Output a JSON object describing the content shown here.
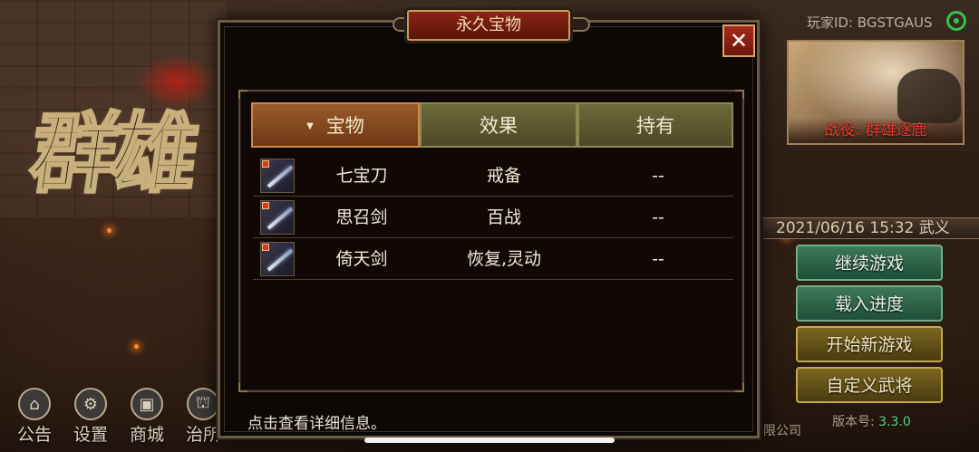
{
  "background": {
    "logo_text": "群雄",
    "player_id": "玩家ID: BGSTGAUS",
    "campaign_title": "战役: 群雄逐鹿",
    "save_info": "2021/06/16 15:32 武义",
    "company_text": "限公司",
    "version_label": "版本号: ",
    "version_value": "3.3.0",
    "menu_buttons": [
      "继续游戏",
      "载入进度",
      "开始新游戏",
      "自定义武将"
    ],
    "bottom_menu": [
      {
        "label": "公告",
        "icon": "notice-icon"
      },
      {
        "label": "设置",
        "icon": "gear-icon"
      },
      {
        "label": "商城",
        "icon": "shop-icon"
      },
      {
        "label": "治所",
        "icon": "pavilion-icon"
      }
    ]
  },
  "modal": {
    "title": "永久宝物",
    "close_label": "✕",
    "columns": [
      {
        "label": "宝物",
        "active": true,
        "sort_indicator": "▼"
      },
      {
        "label": "效果",
        "active": false
      },
      {
        "label": "持有",
        "active": false
      }
    ],
    "rows": [
      {
        "name": "七宝刀",
        "effect": "戒备",
        "held": "--"
      },
      {
        "name": "思召剑",
        "effect": "百战",
        "held": "--"
      },
      {
        "name": "倚天剑",
        "effect": "恢复,灵动",
        "held": "--"
      }
    ],
    "status_text": "点击查看详细信息。"
  },
  "colors": {
    "active_header": "#9a5a2a",
    "inactive_header": "#6f6a3a",
    "title_plate": "#8a2415",
    "campaign_title": "#e53b2d",
    "green_button": "#3d7a5a",
    "gold_button": "#7a6620"
  }
}
